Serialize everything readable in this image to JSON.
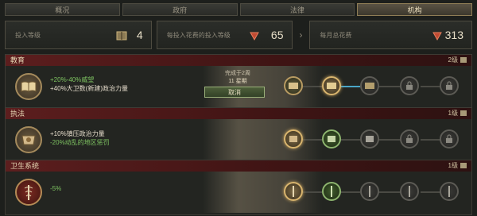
{
  "tabs": [
    {
      "label": "概况",
      "active": false
    },
    {
      "label": "政府",
      "active": false
    },
    {
      "label": "法律",
      "active": false
    },
    {
      "label": "机构",
      "active": true
    }
  ],
  "summary": {
    "box1": {
      "label": "投入等级",
      "value": "4"
    },
    "box2": {
      "label": "每投入花费的投入等级",
      "value": "65"
    },
    "box3": {
      "label": "每月总花费",
      "value": "313"
    }
  },
  "sections": [
    {
      "title": "教育",
      "level": "2级",
      "effects": [
        "+20%-40%威望",
        "+40%大卫数(新建)政治力量"
      ],
      "popup": {
        "title": "完成于2周",
        "time": "11 星期",
        "button": "取消"
      }
    },
    {
      "title": "执法",
      "level": "1级",
      "effects": [
        "+10%镇压政治力量",
        "-20%动乱的地区惩罚"
      ]
    },
    {
      "title": "卫生系统",
      "level": "1级",
      "effects": [
        "-5%"
      ]
    }
  ],
  "colors": {
    "accent_red": "#5c1e1e",
    "gold": "#b89b62",
    "green_text": "#7ec361"
  }
}
